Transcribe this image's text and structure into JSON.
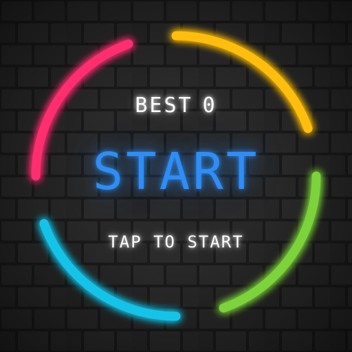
{
  "menu": {
    "best_label": "BEST",
    "best_score": "0",
    "start_label": "START",
    "tap_hint": "TAP TO START"
  },
  "ring": {
    "segments": [
      {
        "name": "red-segment",
        "color": "#ff2d6f"
      },
      {
        "name": "yellow-segment",
        "color": "#ffbe0b"
      },
      {
        "name": "green-segment",
        "color": "#7bd33a"
      },
      {
        "name": "cyan-segment",
        "color": "#12c3e8"
      }
    ]
  },
  "colors": {
    "background": "#202020",
    "brick": "#2a2a2a",
    "start_text": "#2f8df5",
    "label_text": "#ffffff"
  }
}
